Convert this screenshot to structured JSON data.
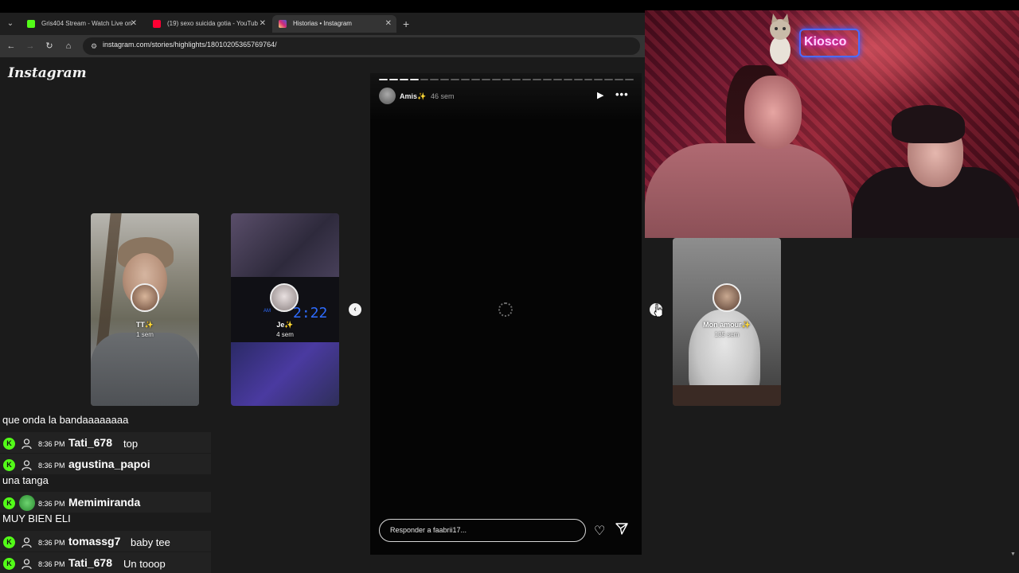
{
  "browser": {
    "tabs": [
      {
        "label": "Gris404 Stream - Watch Live on",
        "favicon_color": "#53fc18"
      },
      {
        "label": "(19) sexo suicida gotia - YouTub",
        "favicon_color": "#ff0033"
      },
      {
        "label": "Historias • Instagram",
        "favicon_color": "#d62976"
      }
    ],
    "new_tab": "+",
    "url": "instagram.com/stories/highlights/18010205365769764/"
  },
  "instagram": {
    "logo": "Instagram",
    "stories_left": [
      {
        "name": "TT✨",
        "age": "1 sem"
      },
      {
        "name": "Je✨",
        "age": "4 sem",
        "clock": "2:22",
        "clock_ampm": "AM"
      }
    ],
    "stories_right": [
      {
        "name": "Mon amour✨",
        "age": "135 sem"
      }
    ],
    "viewer": {
      "username": "Amis✨",
      "time": "46 sem",
      "progress_total": 25,
      "progress_done": 4,
      "reply_placeholder": "Responder a faabrii17..."
    }
  },
  "webcam": {
    "sign_text": "Kiosco"
  },
  "chat": [
    {
      "type": "plain",
      "text": "que onda la bandaaaaaaaa"
    },
    {
      "type": "msg",
      "time": "8:36 PM",
      "user": "Tati_678",
      "text": "top",
      "avatar": false
    },
    {
      "type": "msg",
      "time": "8:36 PM",
      "user": "agustina_papoi",
      "text": "",
      "avatar": false
    },
    {
      "type": "plain",
      "text": "una tanga"
    },
    {
      "type": "msg",
      "time": "8:36 PM",
      "user": "Memimiranda",
      "text": "",
      "avatar": true
    },
    {
      "type": "plain",
      "text": "MUY BIEN ELI"
    },
    {
      "type": "msg",
      "time": "8:36 PM",
      "user": "tomassg7",
      "text": "baby tee",
      "avatar": false
    },
    {
      "type": "msg",
      "time": "8:36 PM",
      "user": "Tati_678",
      "text": "Un tooop",
      "avatar": false
    }
  ],
  "colors": {
    "kick_green": "#53fc18",
    "ig_background": "#1b1b1b",
    "viewer_background": "#050505"
  }
}
